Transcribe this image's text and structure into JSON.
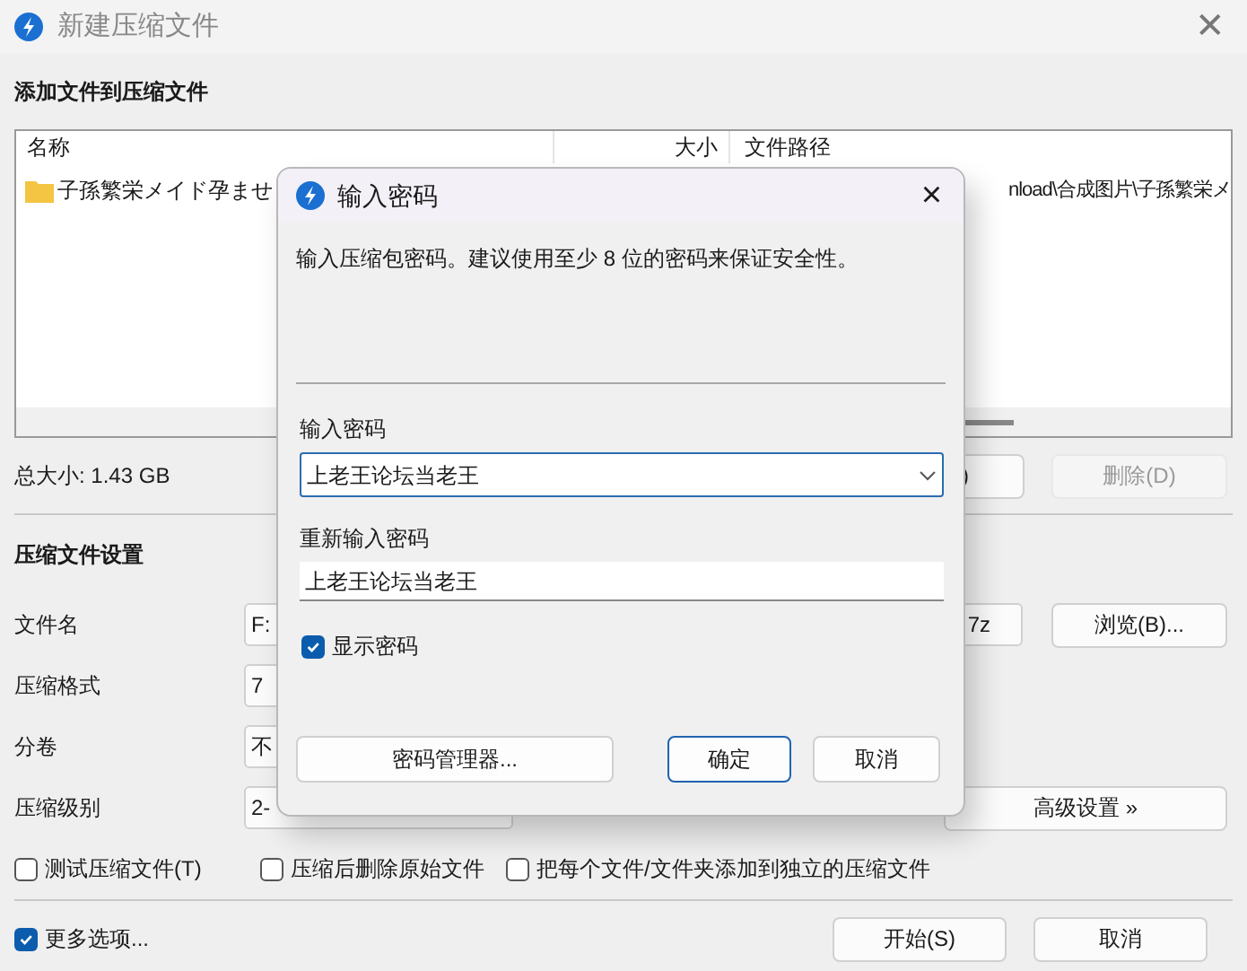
{
  "window": {
    "title": "新建压缩文件",
    "close": "✕"
  },
  "add_section": {
    "title": "添加文件到压缩文件"
  },
  "file_list": {
    "columns": [
      {
        "label": "名称"
      },
      {
        "label": "大小"
      },
      {
        "label": "文件路径"
      }
    ],
    "rows": [
      {
        "name": "子孫繁栄メイド孕ませ",
        "path": "nload\\合成图片\\子孫繁栄メ"
      }
    ]
  },
  "total_size": "总大小: 1.43 GB",
  "list_buttons": [
    {
      "label": ")",
      "disabled": false
    },
    {
      "label": "删除(D)",
      "disabled": true
    }
  ],
  "settings": {
    "title": "压缩文件设置",
    "rows": [
      {
        "label": "文件名",
        "value": "F:",
        "value_end": "7z",
        "button": "浏览(B)..."
      },
      {
        "label": "压缩格式",
        "value": "7"
      },
      {
        "label": "分卷",
        "value": "不"
      },
      {
        "label": "压缩级别",
        "value": "2-",
        "button": "高级设置 »"
      }
    ]
  },
  "options": [
    {
      "label": "测试压缩文件(T)",
      "checked": false
    },
    {
      "label": "压缩后删除原始文件",
      "checked": false
    },
    {
      "label": "把每个文件/文件夹添加到独立的压缩文件",
      "checked": false
    }
  ],
  "more_options": {
    "label": "更多选项...",
    "checked": true
  },
  "buttons": [
    {
      "label": "开始(S)"
    },
    {
      "label": "取消"
    }
  ],
  "dialog": {
    "title": "输入密码",
    "close": "×",
    "message": "输入压缩包密码。建议使用至少 8 位的密码来保证安全性。",
    "password_label": "输入密码",
    "password": "上老王论坛当老王",
    "confirm_label": "重新输入密码",
    "confirm": "上老王论坛当老王",
    "show_password": {
      "label": "显示密码",
      "checked": true
    },
    "buttons": [
      {
        "label": "密码管理器...",
        "default": false
      },
      {
        "label": "确定",
        "default": true
      },
      {
        "label": "取消",
        "default": false
      }
    ]
  }
}
